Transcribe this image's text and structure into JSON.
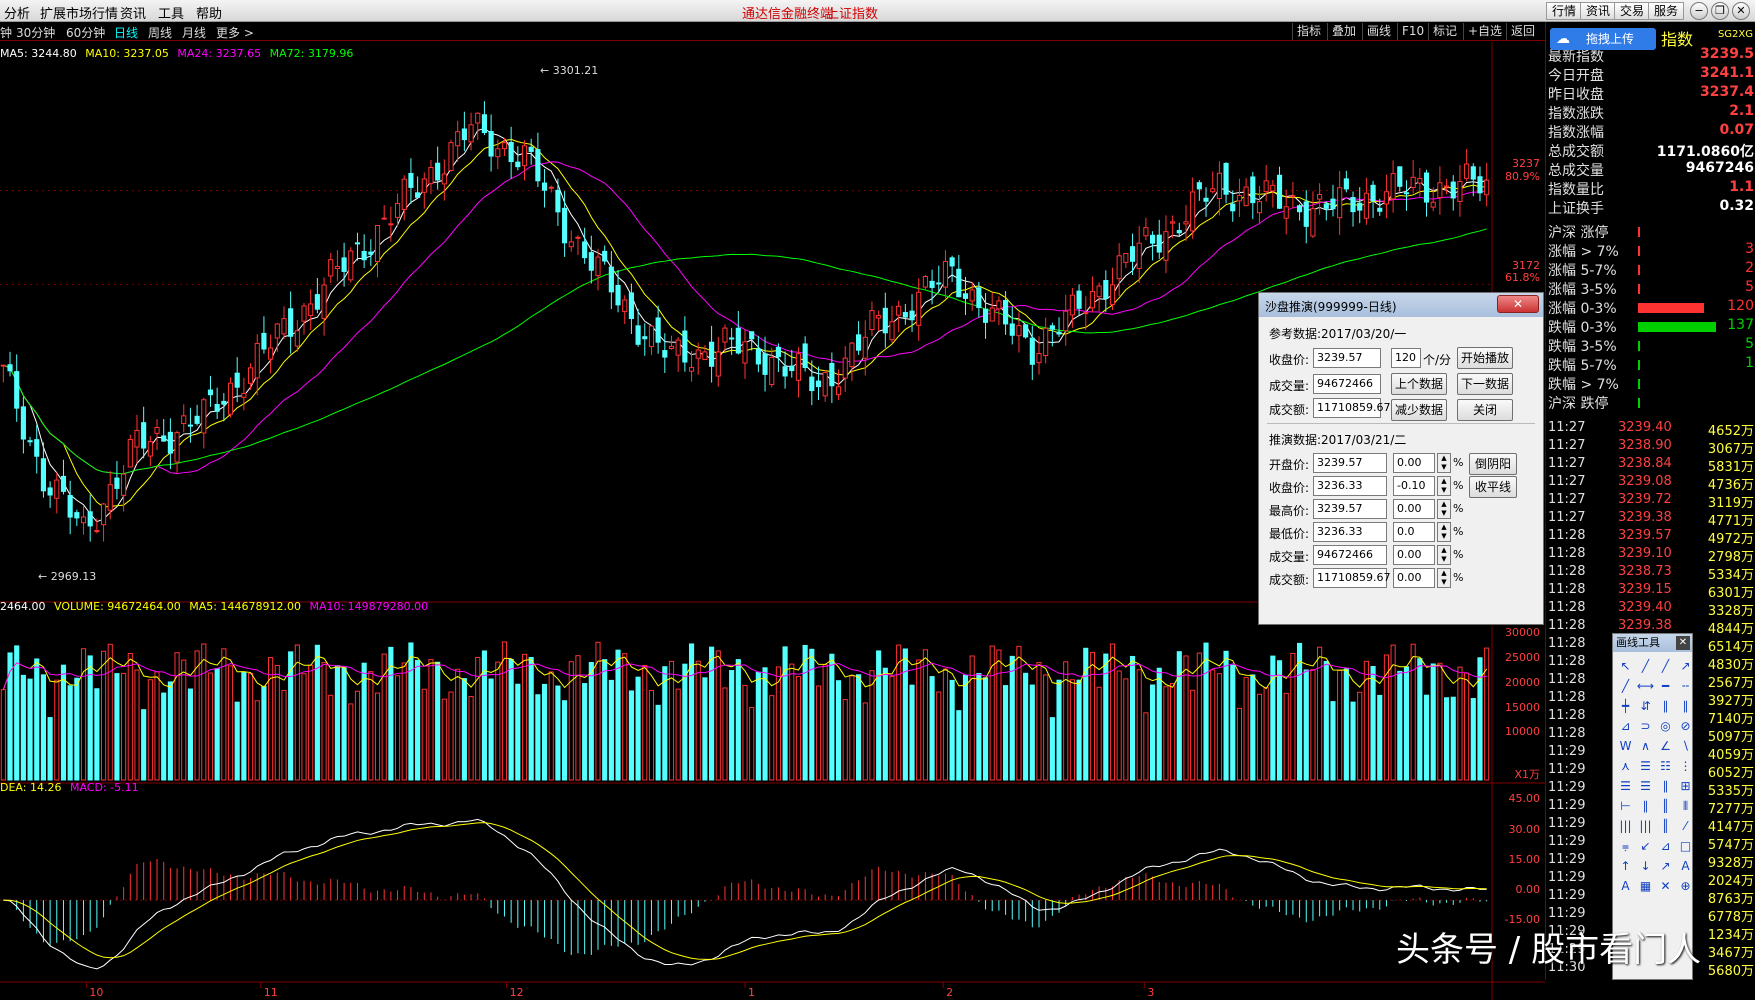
{
  "menu": {
    "items": [
      "分析",
      "扩展市场行情",
      "资讯",
      "工具",
      "帮助"
    ],
    "title_left": "通达信金融终端",
    "title_right": "上证指数",
    "right_buttons": [
      "行情",
      "资讯",
      "交易",
      "服务"
    ],
    "window_buttons": [
      "−",
      "❐",
      "✕"
    ]
  },
  "periods": {
    "items": [
      "钟",
      "30分钟",
      "60分钟",
      "日线",
      "周线",
      "月线",
      "更多 >"
    ],
    "active_index": 3,
    "toolbar": [
      "指标",
      "叠加",
      "画线",
      "F10",
      "标记",
      "+自选",
      "返回"
    ]
  },
  "ma_legend": {
    "ma5": "MA5: 3244.80",
    "ma10": "MA10: 3237.05",
    "ma24": "MA24: 3237.65",
    "ma72": "MA72: 3179.96"
  },
  "vol_legend": {
    "cur": "2464.00",
    "volume": "VOLUME: 94672464.00",
    "ma5": "MA5: 144678912.00",
    "ma10": "MA10: 149879280.00"
  },
  "macd_legend": {
    "dea": "DEA: 14.26",
    "macd": "MACD: -5.11"
  },
  "price_axis": {
    "tick1": "3237",
    "tick1_pct": "80.9%",
    "tick2": "3172",
    "tick2_pct": "61.8%"
  },
  "annotations": {
    "high": "3301.21",
    "low": "2969.13"
  },
  "vol_axis": [
    "30000",
    "25000",
    "20000",
    "15000",
    "10000"
  ],
  "vol_unit": "X1万",
  "macd_axis": [
    "45.00",
    "30.00",
    "15.00",
    "0.00",
    "-15.00"
  ],
  "date_axis": [
    "10",
    "11",
    "12",
    "1",
    "2",
    "3"
  ],
  "colors": {
    "up": "#ff3232",
    "down": "#54ffff",
    "ma5": "#ffffff",
    "ma10": "#ffff00",
    "ma24": "#ff00ff",
    "ma72": "#00ff00"
  },
  "quote": {
    "header": "指数",
    "code": "SG2XG",
    "rows": [
      {
        "k": "最新指数",
        "v": "3239.5"
      },
      {
        "k": "今日开盘",
        "v": "3241.1"
      },
      {
        "k": "昨日收盘",
        "v": "3237.4"
      },
      {
        "k": "指数涨跌",
        "v": "2.1"
      },
      {
        "k": "指数涨幅",
        "v": "0.07"
      },
      {
        "k": "总成交额",
        "v": "1171.0860亿"
      },
      {
        "k": "总成交量",
        "v": "9467246"
      },
      {
        "k": "指数量比",
        "v": "1.1"
      },
      {
        "k": "上证换手",
        "v": "0.32"
      }
    ]
  },
  "distribution": [
    {
      "k": "沪深 涨停",
      "v": "",
      "bar": 0.0,
      "color": "#ff3232"
    },
    {
      "k": "涨幅 > 7%",
      "v": "3",
      "bar": 0.02,
      "color": "#ff3232"
    },
    {
      "k": "涨幅 5-7%",
      "v": "2",
      "bar": 0.02,
      "color": "#ff3232"
    },
    {
      "k": "涨幅 3-5%",
      "v": "5",
      "bar": 0.02,
      "color": "#ff3232"
    },
    {
      "k": "涨幅 0-3%",
      "v": "120",
      "bar": 0.85,
      "color": "#ff3232"
    },
    {
      "k": "跌幅 0-3%",
      "v": "137",
      "bar": 1.0,
      "color": "#00d000"
    },
    {
      "k": "跌幅 3-5%",
      "v": "5",
      "bar": 0.02,
      "color": "#00d000"
    },
    {
      "k": "跌幅 5-7%",
      "v": "1",
      "bar": 0.02,
      "color": "#00d000"
    },
    {
      "k": "跌幅 > 7%",
      "v": "",
      "bar": 0.02,
      "color": "#00d000"
    },
    {
      "k": "沪深 跌停",
      "v": "",
      "bar": 0.0,
      "color": "#00d000"
    }
  ],
  "ticks": [
    {
      "t": "11:27",
      "p": "3239.40",
      "v": "4652万"
    },
    {
      "t": "11:27",
      "p": "3238.90",
      "v": "3067万"
    },
    {
      "t": "11:27",
      "p": "3238.84",
      "v": "5831万"
    },
    {
      "t": "11:27",
      "p": "3239.08",
      "v": "4736万"
    },
    {
      "t": "11:27",
      "p": "3239.72",
      "v": "3119万"
    },
    {
      "t": "11:27",
      "p": "3239.38",
      "v": "4771万"
    },
    {
      "t": "11:28",
      "p": "3239.57",
      "v": "4972万"
    },
    {
      "t": "11:28",
      "p": "3239.10",
      "v": "2798万"
    },
    {
      "t": "11:28",
      "p": "3238.73",
      "v": "5334万"
    },
    {
      "t": "11:28",
      "p": "3239.15",
      "v": "6301万"
    },
    {
      "t": "11:28",
      "p": "3239.40",
      "v": "3328万"
    },
    {
      "t": "11:28",
      "p": "3239.38",
      "v": "4844万"
    },
    {
      "t": "11:28",
      "p": "",
      "v": "6514万"
    },
    {
      "t": "11:28",
      "p": "",
      "v": "4830万"
    },
    {
      "t": "11:28",
      "p": "",
      "v": "2567万"
    },
    {
      "t": "11:28",
      "p": "",
      "v": "3927万"
    },
    {
      "t": "11:28",
      "p": "",
      "v": "7140万"
    },
    {
      "t": "11:28",
      "p": "",
      "v": "5097万"
    },
    {
      "t": "11:29",
      "p": "",
      "v": "4059万"
    },
    {
      "t": "11:29",
      "p": "",
      "v": "6052万"
    },
    {
      "t": "11:29",
      "p": "",
      "v": "5335万"
    },
    {
      "t": "11:29",
      "p": "",
      "v": "7277万"
    },
    {
      "t": "11:29",
      "p": "",
      "v": "4147万"
    },
    {
      "t": "11:29",
      "p": "",
      "v": "5747万"
    },
    {
      "t": "11:29",
      "p": "",
      "v": "9328万"
    },
    {
      "t": "11:29",
      "p": "",
      "v": "2024万"
    },
    {
      "t": "11:29",
      "p": "",
      "v": "8763万"
    },
    {
      "t": "11:29",
      "p": "",
      "v": "6778万"
    },
    {
      "t": "11:29",
      "p": "",
      "v": "1234万"
    },
    {
      "t": "11:29",
      "p": "",
      "v": "3467万"
    },
    {
      "t": "11:30",
      "p": "",
      "v": "5680万"
    }
  ],
  "upload": "拖拽上传",
  "dialog": {
    "title": "沙盘推演(999999-日线)",
    "close": "✕",
    "ref_label": "参考数据:2017/03/20/一",
    "close_label": "收盘价:",
    "close_val": "3239.57",
    "vol_label": "成交量:",
    "vol_val": "94672466",
    "amt_label": "成交额:",
    "amt_val": "11710859.67",
    "count_val": "120",
    "count_unit": "个/分",
    "btn_play": "开始播放",
    "btn_prev": "上个数据",
    "btn_next": "下一数据",
    "btn_less": "减少数据",
    "btn_close": "关闭",
    "sim_label": "推演数据:2017/03/21/二",
    "rows": [
      {
        "k": "开盘价:",
        "v": "3239.57",
        "pct": "0.00"
      },
      {
        "k": "收盘价:",
        "v": "3236.33",
        "pct": "-0.10"
      },
      {
        "k": "最高价:",
        "v": "3239.57",
        "pct": "0.00"
      },
      {
        "k": "最低价:",
        "v": "3236.33",
        "pct": "0.0"
      },
      {
        "k": "成交量:",
        "v": "94672466",
        "pct": "0.00"
      },
      {
        "k": "成交额:",
        "v": "11710859.67",
        "pct": "0.00"
      }
    ],
    "pct_sign": "%",
    "btn_yinyang": "倒阴阳",
    "btn_flat": "收平线"
  },
  "draw_tools": {
    "title": "画线工具",
    "close": "✕",
    "icons": [
      "↖",
      "╱",
      "╱",
      "↗",
      "╱",
      "⟷",
      "━",
      "╌",
      "┿",
      "⇵",
      "∥",
      "∥",
      "⊿",
      "⊃",
      "◎",
      "⊘",
      "W",
      "∧",
      "∠",
      "∖",
      "⋏",
      "☰",
      "☷",
      "⋮",
      "☰",
      "☰",
      "∥",
      "⊞",
      "⊢",
      "∥",
      "║",
      "⦀",
      "|||",
      "|||",
      "║",
      "⁄",
      "⩦",
      "↙",
      "⊿",
      "□",
      "↑",
      "↓",
      "↗",
      "A",
      "A",
      "▦",
      "✕",
      "⊕"
    ]
  },
  "watermark": "头条号 / 股市看门人"
}
